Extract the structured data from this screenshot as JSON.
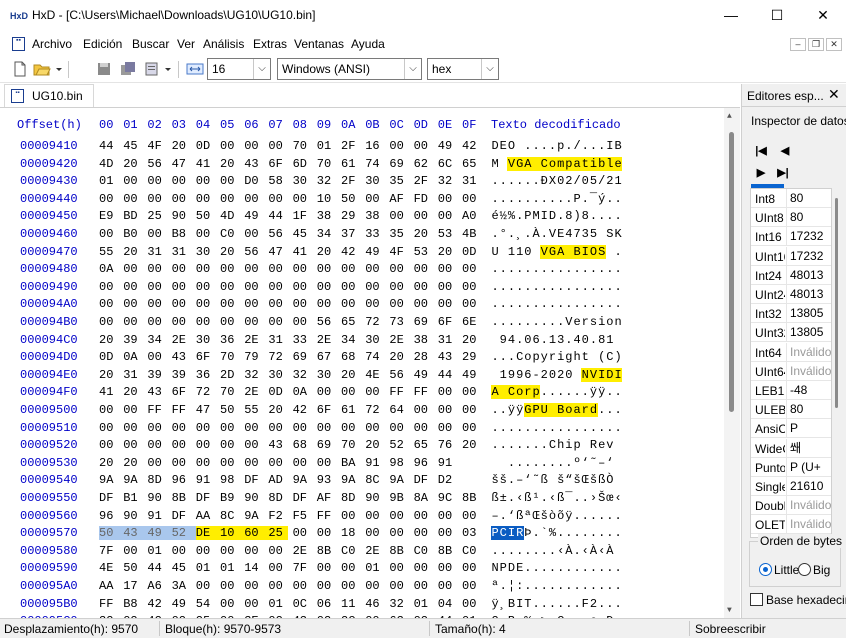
{
  "window": {
    "title": "HxD - [C:\\Users\\Michael\\Downloads\\UG10\\UG10.bin]",
    "app_icon_text": "HxD",
    "minimize": "—",
    "maximize": "☐",
    "close": "✕"
  },
  "menu": [
    "Archivo",
    "Edición",
    "Buscar",
    "Ver",
    "Análisis",
    "Extras",
    "Ventanas",
    "Ayuda"
  ],
  "toolbar": {
    "bytes_per_row": "16",
    "charset": "Windows (ANSI)",
    "offset_base": "hex"
  },
  "document_tab": "UG10.bin",
  "hex_header": {
    "offset": "Offset(h)",
    "columns": [
      "00",
      "01",
      "02",
      "03",
      "04",
      "05",
      "06",
      "07",
      "08",
      "09",
      "0A",
      "0B",
      "0C",
      "0D",
      "0E",
      "0F"
    ],
    "text": "Texto decodificado"
  },
  "rows": [
    {
      "off": "00009410",
      "hex": "44 45 4F 20 0D 00 00 00 70 01 2F 16 00 00 49 42",
      "txt": "DEO ....p./...IB"
    },
    {
      "off": "00009420",
      "hex": "4D 20 56 47 41 20 43 6F 6D 70 61 74 69 62 6C 65",
      "txt": "M VGA Compatible"
    },
    {
      "off": "00009430",
      "hex": "01 00 00 00 00 00 D0 58 30 32 2F 30 35 2F 32 31",
      "txt": "......ÐX02/05/21"
    },
    {
      "off": "00009440",
      "hex": "00 00 00 00 00 00 00 00 00 10 50 00 AF FD 00 00",
      "txt": "..........P.¯ý.."
    },
    {
      "off": "00009450",
      "hex": "E9 BD 25 90 50 4D 49 44 1F 38 29 38 00 00 00 A0",
      "txt": "é½%.PMID.8)8.... "
    },
    {
      "off": "00009460",
      "hex": "00 B0 00 B8 00 C0 00 56 45 34 37 33 35 20 53 4B",
      "txt": ".°.¸.À.VE4735 SK"
    },
    {
      "off": "00009470",
      "hex": "55 20 31 31 30 20 56 47 41 20 42 49 4F 53 20 0D",
      "txt": "U 110 VGA BIOS ."
    },
    {
      "off": "00009480",
      "hex": "0A 00 00 00 00 00 00 00 00 00 00 00 00 00 00 00",
      "txt": "................"
    },
    {
      "off": "00009490",
      "hex": "00 00 00 00 00 00 00 00 00 00 00 00 00 00 00 00",
      "txt": "................"
    },
    {
      "off": "000094A0",
      "hex": "00 00 00 00 00 00 00 00 00 00 00 00 00 00 00 00",
      "txt": "................"
    },
    {
      "off": "000094B0",
      "hex": "00 00 00 00 00 00 00 00 00 56 65 72 73 69 6F 6E",
      "txt": ".........Version"
    },
    {
      "off": "000094C0",
      "hex": "20 39 34 2E 30 36 2E 31 33 2E 34 30 2E 38 31 20",
      "txt": " 94.06.13.40.81 "
    },
    {
      "off": "000094D0",
      "hex": "0D 0A 00 43 6F 70 79 72 69 67 68 74 20 28 43 29",
      "txt": "...Copyright (C)"
    },
    {
      "off": "000094E0",
      "hex": "20 31 39 39 36 2D 32 30 32 30 20 4E 56 49 44 49",
      "txt": " 1996-2020 NVIDI"
    },
    {
      "off": "000094F0",
      "hex": "41 20 43 6F 72 70 2E 0D 0A 00 00 00 FF FF 00 00",
      "txt": "A Corp......ÿÿ.."
    },
    {
      "off": "00009500",
      "hex": "00 00 FF FF 47 50 55 20 42 6F 61 72 64 00 00 00",
      "txt": "..ÿÿGPU Board..."
    },
    {
      "off": "00009510",
      "hex": "00 00 00 00 00 00 00 00 00 00 00 00 00 00 00 00",
      "txt": "................"
    },
    {
      "off": "00009520",
      "hex": "00 00 00 00 00 00 00 43 68 69 70 20 52 65 76 20",
      "txt": ".......Chip Rev "
    },
    {
      "off": "00009530",
      "hex": "20 20 00 00 00 00 00 00 00 00 BA 91 98 96 91",
      "txt": "  ........º‘˜–‘ "
    },
    {
      "off": "00009540",
      "hex": "9A 9A 8D 96 91 98 DF AD 9A 93 9A 8C 9A DF D2",
      "txt": "šš.–‘˜ß­š“šŒšßÒ "
    },
    {
      "off": "00009550",
      "hex": "DF B1 90 8B DF B9 90 8D DF AF 8D 90 9B 8A 9C 8B",
      "txt": "ß±.‹ß¹.‹ß¯..›Šœ‹"
    },
    {
      "off": "00009560",
      "hex": "96 90 91 DF AA 8C 9A F2 F5 FF 00 00 00 00 00 00",
      "txt": "–.‘ßªŒšòõÿ......"
    },
    {
      "off": "00009570",
      "hex": "50 43 49 52 DE 10 60 25 00 00 18 00 00 00 00 03",
      "txt": "PCIRÞ.`%........"
    },
    {
      "off": "00009580",
      "hex": "7F 00 01 00 00 00 00 00 2E 8B C0 2E 8B C0 8B C0",
      "txt": "........‹À.‹À‹À"
    },
    {
      "off": "00009590",
      "hex": "4E 50 44 45 01 01 14 00 7F 00 00 01 00 00 00 00",
      "txt": "NPDE............"
    },
    {
      "off": "000095A0",
      "hex": "AA 17 A6 3A 00 00 00 00 00 00 00 00 00 00 00 00",
      "txt": "ª.¦:............"
    },
    {
      "off": "000095B0",
      "hex": "FF B8 42 49 54 00 00 01 0C 06 11 46 32 01 04 00",
      "txt": "ÿ¸BIT......F2..."
    },
    {
      "off": "000095C0",
      "hex": "32 02 42 02 25 00 3E 02 43 02 2C 00 63 02 44 01",
      "txt": "2.B.%.>.C.,.c.D."
    },
    {
      "off": "000095D0",
      "hex": "04 00 8F 02 49 01 24 00 93 02 4D 02 29 00 B7 02",
      "txt": "....I.$.“.M.).·."
    },
    {
      "off": "000095E0",
      "hex": "4E 00 00 00 00 00 50 02 E8 00 E0 02 53 02 18 00",
      "txt": "N.....P.è.à.S..."
    }
  ],
  "inspector": {
    "tab_label": "Editores esp...",
    "tab_close": "✕",
    "title": "Inspector de datos",
    "items": [
      {
        "k": "Int8",
        "v": "80"
      },
      {
        "k": "UInt8",
        "v": "80"
      },
      {
        "k": "Int16",
        "v": "17232"
      },
      {
        "k": "UInt16",
        "v": "17232"
      },
      {
        "k": "Int24",
        "v": "48013"
      },
      {
        "k": "UInt24",
        "v": "48013"
      },
      {
        "k": "Int32",
        "v": "13805"
      },
      {
        "k": "UInt32",
        "v": "13805"
      },
      {
        "k": "Int64",
        "v": "Inválido"
      },
      {
        "k": "UInt64",
        "v": "Inválido"
      },
      {
        "k": "LEB128",
        "v": "-48"
      },
      {
        "k": "ULEB128",
        "v": "80"
      },
      {
        "k": "AnsiChar",
        "v": "P"
      },
      {
        "k": "WideChar",
        "v": "쐐"
      },
      {
        "k": "Punto",
        "v": "P (U+"
      },
      {
        "k": "Single",
        "v": "21610"
      },
      {
        "k": "Double",
        "v": "Inválido"
      },
      {
        "k": "OLETIME",
        "v": "Inválido"
      }
    ],
    "byte_order": "Orden de bytes",
    "little": "Little",
    "big": "Big",
    "base_hex": "Base hexadecimal"
  },
  "status": {
    "offset": "Desplazamiento(h): 9570",
    "block": "Bloque(h): 9570-9573",
    "size": "Tamaño(h): 4",
    "mode": "Sobreescribir"
  }
}
